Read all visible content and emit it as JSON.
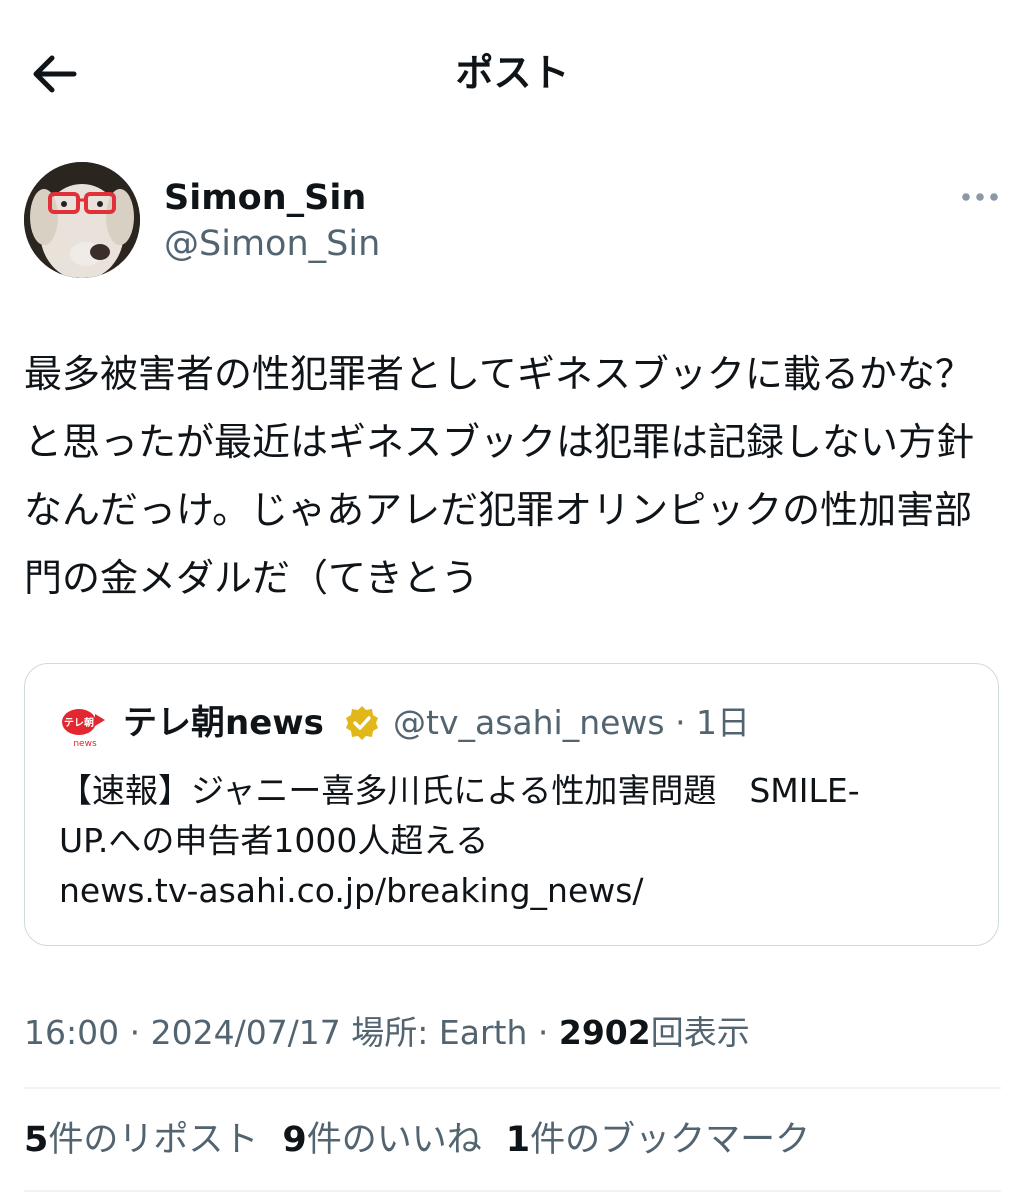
{
  "header": {
    "title": "ポスト",
    "back_icon": "arrow-left-icon"
  },
  "author": {
    "display_name": "Simon_Sin",
    "handle": "@Simon_Sin",
    "more_icon": "more-horizontal-icon"
  },
  "tweet": {
    "text": "最多被害者の性犯罪者としてギネスブックに載るかな？と思ったが最近はギネスブックは犯罪は記録しない方針なんだっけ。じゃあアレだ犯罪オリンピックの性加害部門の金メダルだ（てきとう"
  },
  "quote": {
    "name": "テレ朝news",
    "handle_time": "@tv_asahi_news · 1日",
    "avatar_label": "テレ朝",
    "avatar_sub": "news",
    "text_line1": "【速報】ジャニー喜多川氏による性加害問題　SMILE-",
    "text_line2": "UP.への申告者1000人超える",
    "link": "news.tv-asahi.co.jp/breaking_news/",
    "verified_color": "#e2b719"
  },
  "meta": {
    "time": "16:00",
    "sep1": " · ",
    "date": "2024/07/17",
    "location": " 場所: Earth",
    "sep2": " · ",
    "views_count": "2902",
    "views_label": "回表示"
  },
  "stats": [
    {
      "count": "5",
      "label": "件のリポスト"
    },
    {
      "count": "9",
      "label": "件のいいね"
    },
    {
      "count": "1",
      "label": "件のブックマーク"
    }
  ],
  "colors": {
    "text": "#0f1419",
    "secondary": "#536471",
    "border": "#cfd9de"
  }
}
